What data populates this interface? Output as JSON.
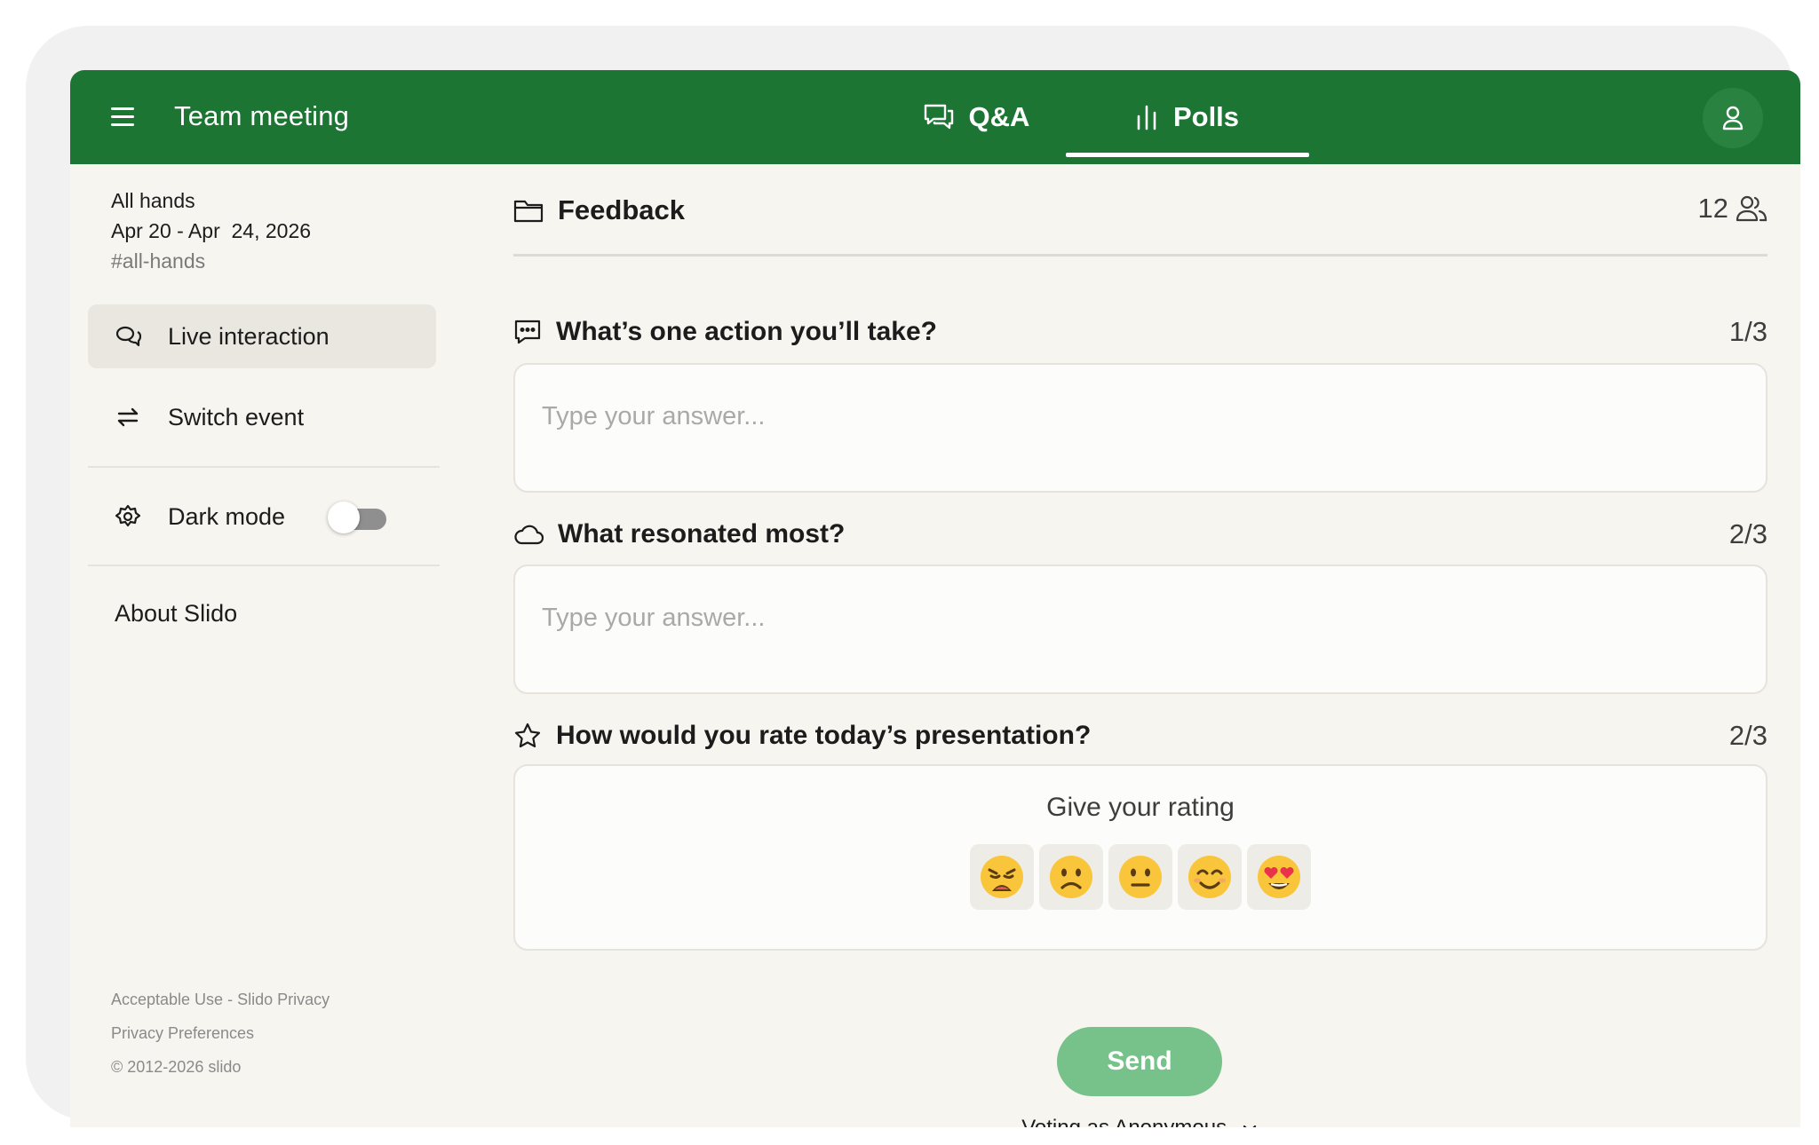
{
  "header": {
    "title": "Team meeting",
    "tabs": [
      {
        "label": "Q&A",
        "icon": "chat-bubbles-icon"
      },
      {
        "label": "Polls",
        "icon": "bar-chart-icon",
        "active": true
      }
    ]
  },
  "sidebar": {
    "event_name": "All hands",
    "event_dates": "Apr 20 - Apr  24, 2026",
    "event_code": "#all-hands",
    "items": [
      {
        "label": "Live interaction",
        "icon": "chat-icon",
        "active": true
      },
      {
        "label": "Switch event",
        "icon": "swap-arrows-icon"
      },
      {
        "label": "Dark mode",
        "icon": "gear-icon",
        "toggle": false
      }
    ],
    "about": "About Slido",
    "footer": {
      "acceptable_use": "Acceptable Use",
      "separator": " - ",
      "slido_privacy": "Slido Privacy",
      "privacy_preferences": "Privacy Preferences",
      "copyright": "© 2012-2026 slido"
    }
  },
  "main": {
    "section_title": "Feedback",
    "participants": "12",
    "questions": [
      {
        "title": "What’s one action you’ll take?",
        "count": "1/3",
        "placeholder": "Type your answer...",
        "icon": "comment-icon"
      },
      {
        "title": "What resonated most?",
        "count": "2/3",
        "placeholder": "Type your answer...",
        "icon": "cloud-icon"
      },
      {
        "title": "How would you rate today’s presentation?",
        "count": "2/3",
        "icon": "star-icon"
      }
    ],
    "rating": {
      "label": "Give your rating",
      "emojis": [
        "weary",
        "frowning",
        "neutral",
        "smiling",
        "heart-eyes"
      ]
    },
    "send_label": "Send",
    "voting_prefix": "Voting as ",
    "voting_identity": "Anonymous"
  },
  "colors": {
    "header_bg": "#1d7534",
    "page_bg": "#f7f5f0",
    "send_bg": "#77c18a"
  }
}
